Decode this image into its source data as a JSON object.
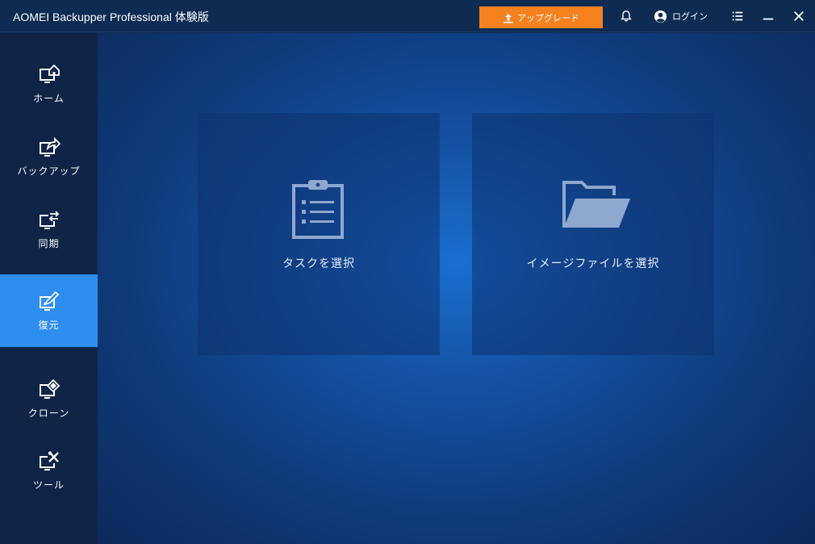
{
  "titlebar": {
    "app_title": "AOMEI Backupper Professional 体験版",
    "upgrade_label": "アップグレード",
    "login_label": "ログイン"
  },
  "sidebar": {
    "items": [
      {
        "label": "ホーム",
        "icon": "home-icon"
      },
      {
        "label": "バックアップ",
        "icon": "backup-icon"
      },
      {
        "label": "同期",
        "icon": "sync-icon"
      },
      {
        "label": "復元",
        "icon": "restore-icon",
        "active": true
      },
      {
        "label": "クローン",
        "icon": "clone-icon"
      },
      {
        "label": "ツール",
        "icon": "tools-icon"
      }
    ]
  },
  "main": {
    "cards": [
      {
        "label": "タスクを選択",
        "icon": "clipboard-icon"
      },
      {
        "label": "イメージファイルを選択",
        "icon": "folder-icon"
      }
    ]
  },
  "colors": {
    "accent": "#2d8ef0",
    "upgrade": "#f5821f",
    "sidebar_bg": "#0f2447",
    "titlebar_bg": "#0e2b52"
  }
}
